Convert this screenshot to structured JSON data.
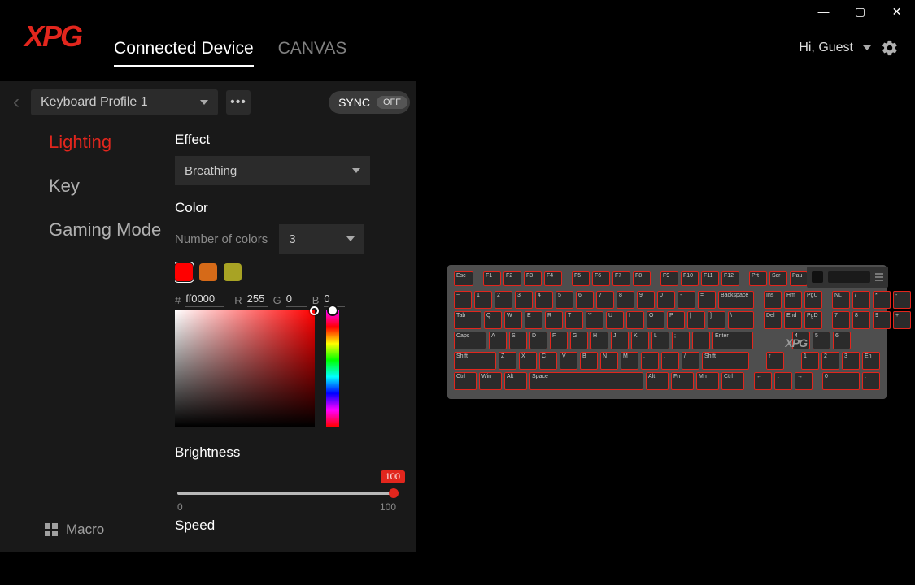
{
  "window": {
    "minimize": "—",
    "maximize": "▢",
    "close": "✕"
  },
  "header": {
    "logo": "XPG",
    "tabs": [
      "Connected Device",
      "CANVAS"
    ],
    "active_tab": 0,
    "user_label": "Hi, Guest"
  },
  "profile": {
    "selected": "Keyboard Profile 1",
    "sync_label": "SYNC",
    "sync_state": "OFF"
  },
  "nav": {
    "items": [
      "Lighting",
      "Key",
      "Gaming Mode"
    ],
    "active": 0,
    "macro": "Macro"
  },
  "settings": {
    "effect_label": "Effect",
    "effect_value": "Breathing",
    "color_label": "Color",
    "numcolors_label": "Number of colors",
    "numcolors_value": "3",
    "swatches": [
      "#ff0000",
      "#d66a18",
      "#a8a324"
    ],
    "selected_swatch": 0,
    "hex_prefix": "#",
    "hex": "ff0000",
    "r_label": "R",
    "r": "255",
    "g_label": "G",
    "g": "0",
    "b_label": "B",
    "b": "0",
    "brightness_label": "Brightness",
    "brightness_value": "100",
    "brightness_min": "0",
    "brightness_max": "100",
    "speed_label": "Speed"
  },
  "keyboard": {
    "logo": "XPG",
    "rows": {
      "fn": [
        "Esc",
        "",
        "F1",
        "F2",
        "F3",
        "F4",
        "",
        "F5",
        "F6",
        "F7",
        "F8",
        "",
        "F9",
        "F10",
        "F11",
        "F12",
        "",
        "Prt",
        "Scr",
        "Pau"
      ],
      "num": [
        "~",
        "1",
        "2",
        "3",
        "4",
        "5",
        "6",
        "7",
        "8",
        "9",
        "0",
        "-",
        "=",
        "Backspace",
        "",
        "Ins",
        "Hm",
        "PgU",
        "",
        "NL",
        "/",
        "*",
        "-"
      ],
      "q": [
        "Tab",
        "Q",
        "W",
        "E",
        "R",
        "T",
        "Y",
        "U",
        "I",
        "O",
        "P",
        "[",
        "]",
        "\\",
        "",
        "Del",
        "End",
        "PgD",
        "",
        "7",
        "8",
        "9",
        "+"
      ],
      "a": [
        "Caps",
        "A",
        "S",
        "D",
        "F",
        "G",
        "H",
        "J",
        "K",
        "L",
        ";",
        "'",
        "Enter",
        "",
        "",
        "",
        "",
        "",
        "4",
        "5",
        "6"
      ],
      "z": [
        "Shift",
        "Z",
        "X",
        "C",
        "V",
        "B",
        "N",
        "M",
        ",",
        ".",
        "/",
        "Shift",
        "",
        "",
        "↑",
        "",
        "",
        "1",
        "2",
        "3",
        "En"
      ],
      "sp": [
        "Ctrl",
        "Win",
        "Alt",
        "Space",
        "Alt",
        "Fn",
        "Mn",
        "Ctrl",
        "",
        "←",
        "↓",
        "→",
        "",
        "0",
        ".",
        ""
      ]
    }
  }
}
